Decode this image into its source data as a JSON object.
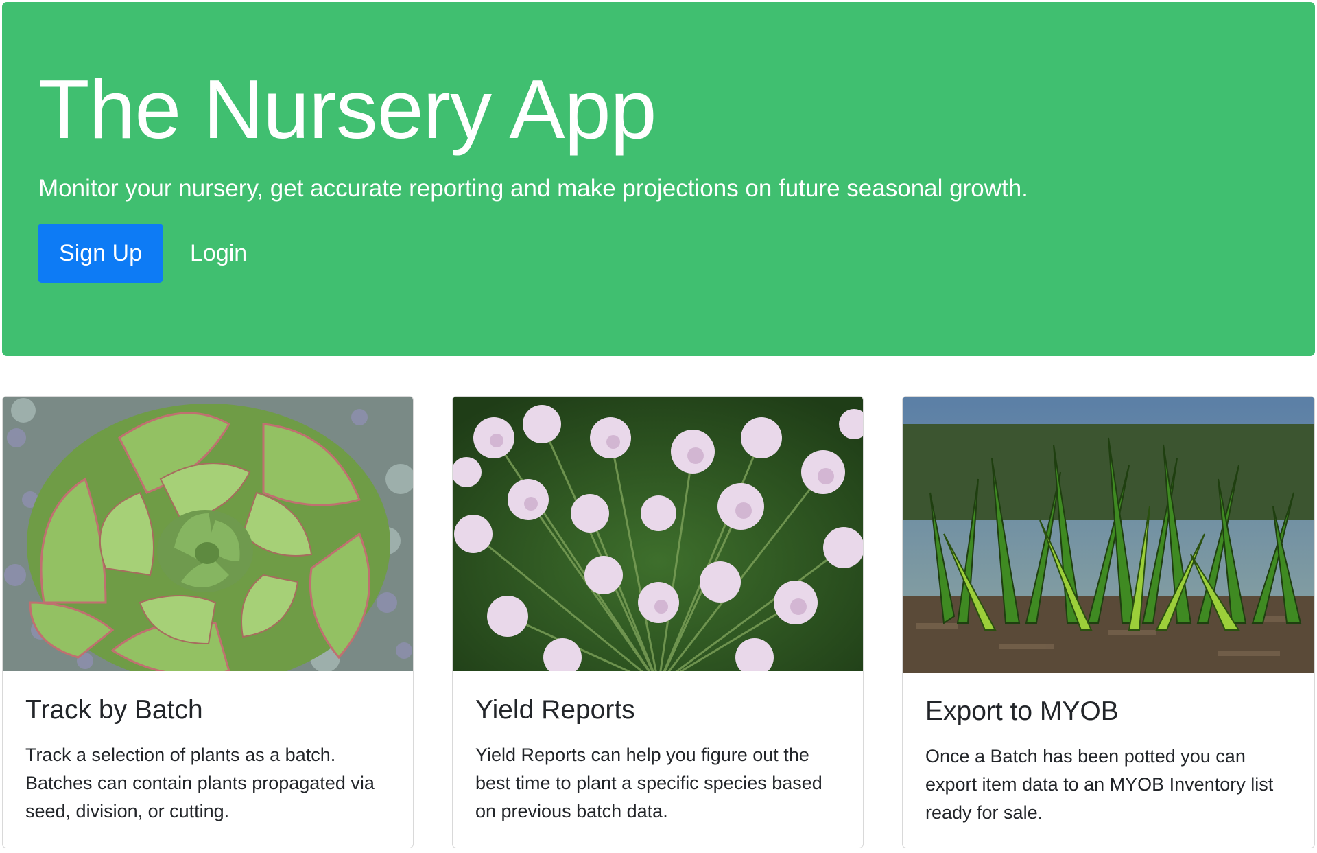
{
  "hero": {
    "title": "The Nursery App",
    "lead": "Monitor your nursery, get accurate reporting and make projections on future seasonal growth.",
    "signup_label": "Sign Up",
    "login_label": "Login",
    "background_color": "#40bf70",
    "button_color": "#0d7bf5"
  },
  "cards": [
    {
      "image": "succulent-rosette-photo",
      "title": "Track by Batch",
      "text": "Track a selection of plants as a batch. Batches can contain plants propagated via seed, division, or cutting."
    },
    {
      "image": "umbel-flower-cluster-photo",
      "title": "Yield Reports",
      "text": "Yield Reports can help you figure out the best time to plant a specific species based on previous batch data."
    },
    {
      "image": "green-seedlings-in-mulch-photo",
      "title": "Export to MYOB",
      "text": "Once a Batch has been potted you can export item data to an MYOB Inventory list ready for sale."
    }
  ]
}
